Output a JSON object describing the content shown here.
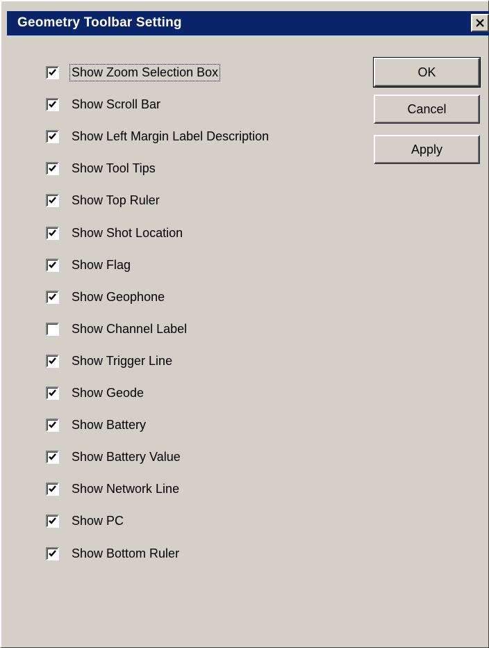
{
  "dialog": {
    "title": "Geometry Toolbar Setting",
    "close_icon": "close-icon"
  },
  "options": [
    {
      "label": "Show Zoom Selection Box",
      "checked": true,
      "focused": true
    },
    {
      "label": "Show Scroll Bar",
      "checked": true
    },
    {
      "label": "Show Left Margin Label Description",
      "checked": true
    },
    {
      "label": "Show Tool Tips",
      "checked": true
    },
    {
      "label": "Show Top Ruler",
      "checked": true
    },
    {
      "label": "Show Shot Location",
      "checked": true
    },
    {
      "label": "Show Flag",
      "checked": true
    },
    {
      "label": "Show Geophone",
      "checked": true
    },
    {
      "label": "Show Channel Label",
      "checked": false
    },
    {
      "label": "Show Trigger Line",
      "checked": true
    },
    {
      "label": "Show Geode",
      "checked": true
    },
    {
      "label": "Show Battery",
      "checked": true
    },
    {
      "label": "Show Battery Value",
      "checked": true
    },
    {
      "label": "Show Network Line",
      "checked": true
    },
    {
      "label": "Show PC",
      "checked": true
    },
    {
      "label": "Show Bottom Ruler",
      "checked": true
    }
  ],
  "buttons": {
    "ok": "OK",
    "cancel": "Cancel",
    "apply": "Apply"
  },
  "colors": {
    "titlebar": "#0a246a",
    "dialog_face": "#d4d0c8"
  }
}
